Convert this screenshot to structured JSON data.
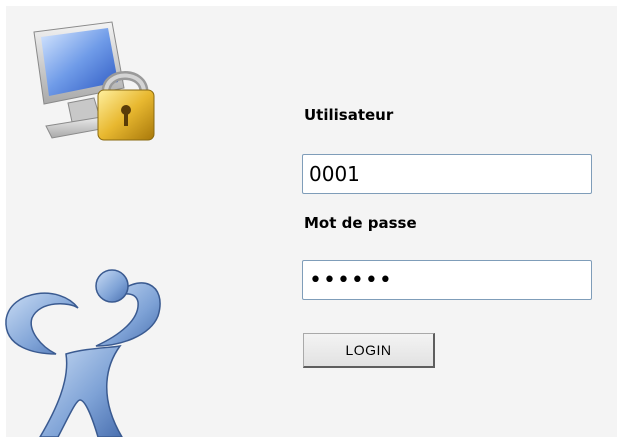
{
  "login_form": {
    "username_label": "Utilisateur",
    "username_value": "0001",
    "password_label": "Mot de passe",
    "password_value": "••••••",
    "login_button_label": "LOGIN"
  },
  "icons": {
    "lock": "computer-lock-icon",
    "logo": "human-figure-logo"
  },
  "colors": {
    "panel_background": "#f4f4f4",
    "input_border": "#7f9db9",
    "button_background": "#e8e8e8"
  }
}
